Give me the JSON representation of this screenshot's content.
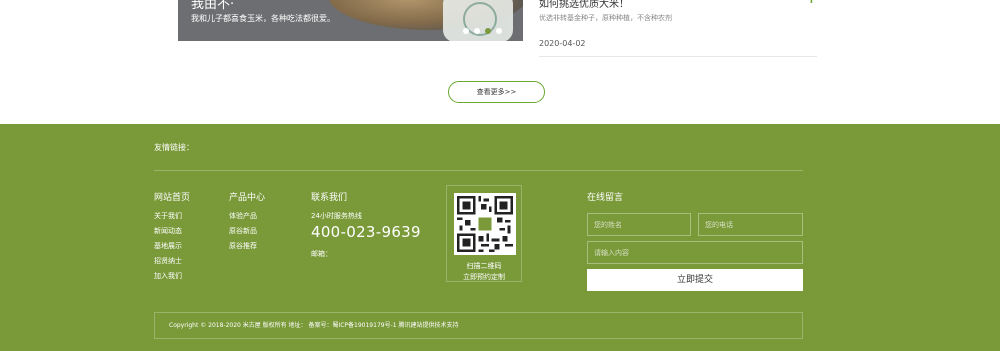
{
  "slide": {
    "title": "我由不·",
    "desc": "我和儿子都喜食玉米，各种吃法都很爱。"
  },
  "news": {
    "title": "如何挑选优质大米！",
    "desc": "优选非转基金种子，原种种植，不含种农剂",
    "date": "2020-04-02",
    "plus": "+"
  },
  "more_label": "查看更多>>",
  "footer": {
    "links_label": "友情链接：",
    "col1": {
      "title": "网站首页",
      "items": [
        "关于我们",
        "新闻动态",
        "基地展示",
        "招贤纳士",
        "加入我们"
      ]
    },
    "col2": {
      "title": "产品中心",
      "items": [
        "体验产品",
        "原谷新品",
        "原谷推荐"
      ]
    },
    "col3": {
      "title": "联系我们",
      "hotline_label": "24小时服务热线",
      "phone": "400-023-9639",
      "email": "邮箱："
    },
    "qr": {
      "line1": "扫描二维码",
      "line2": "立即预约定制"
    },
    "form": {
      "title": "在线留言",
      "name_placeholder": "您的姓名",
      "phone_placeholder": "您的电话",
      "content_placeholder": "请输入内容",
      "submit_label": "立即提交"
    },
    "copyright": "Copyright © 2018-2020 米古屋 版权所有    地址：    备案号：蜀ICP备19019179号-1 腾讯建站提供技术支持"
  },
  "colors": {
    "brand": "#7a9a3a",
    "accent": "#6aa830"
  }
}
